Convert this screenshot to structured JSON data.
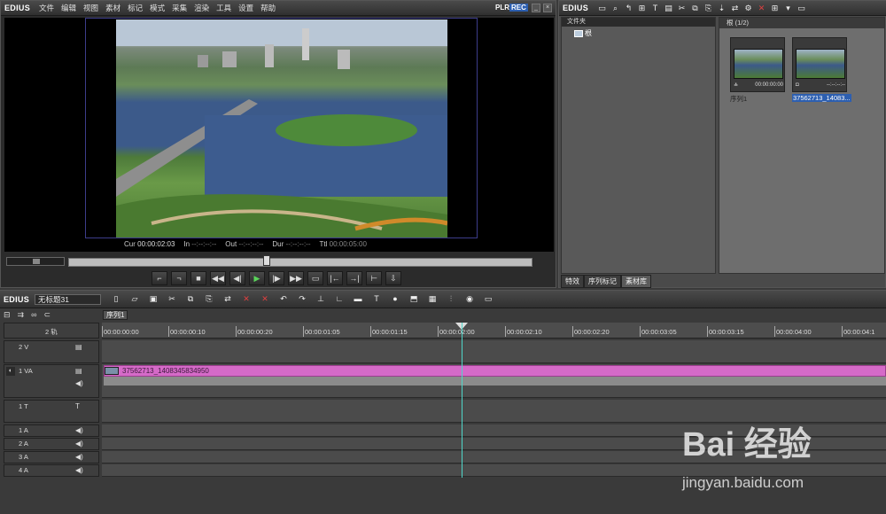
{
  "player": {
    "logo": "EDIUS",
    "menu": [
      "文件",
      "编辑",
      "视图",
      "素材",
      "标记",
      "模式",
      "采集",
      "渲染",
      "工具",
      "设置",
      "帮助"
    ],
    "plr": "PLR",
    "rec": "REC",
    "timecodes": {
      "cur_label": "Cur",
      "cur_value": "00:00:02:03",
      "in_label": "In",
      "in_value": "--:--:--:--",
      "out_label": "Out",
      "out_value": "--:--:--:--",
      "dur_label": "Dur",
      "dur_value": "--:--:--:--",
      "ttl_label": "Ttl",
      "ttl_value": "00:00:05:00"
    },
    "scrub_position": 0.42,
    "transport_icons": [
      "mark-in",
      "mark-out",
      "stop",
      "rewind",
      "step-back",
      "play",
      "step-forward",
      "fast-forward",
      "loop",
      "insert",
      "overwrite",
      "set-in-out",
      "export"
    ]
  },
  "bin": {
    "logo": "EDIUS",
    "folder_header": "文件夹",
    "root_folder": "根",
    "clip_header": "根 (1/2)",
    "clips": [
      {
        "label": "序列1",
        "timecode": "00:00:00:00",
        "selected": false
      },
      {
        "label": "37562713_14083...",
        "timecode": "--:--:--:--",
        "selected": true
      }
    ],
    "tabs": [
      "特效",
      "序列标记",
      "素材库"
    ]
  },
  "timeline": {
    "logo": "EDIUS",
    "project_name": "无标题31",
    "sequence_tab": "序列1",
    "ruler_ticks": [
      "00:00:00:00",
      "00:00:00:10",
      "00:00:00:20",
      "00:00:01:05",
      "00:00:01:15",
      "00:00:02:00",
      "00:00:02:10",
      "00:00:02:20",
      "00:00:03:05",
      "00:00:03:15",
      "00:00:04:00",
      "00:00:04:1"
    ],
    "track_count": "2 轨",
    "tracks": [
      {
        "name": "2 V"
      },
      {
        "name": "1 VA"
      },
      {
        "name": "1 T"
      },
      {
        "name": "1 A"
      },
      {
        "name": "2 A"
      },
      {
        "name": "3 A"
      },
      {
        "name": "4 A"
      }
    ],
    "clip_name": "37562713_1408345834950"
  },
  "watermark": {
    "brand": "Bai 经验",
    "url": "jingyan.baidu.com"
  }
}
